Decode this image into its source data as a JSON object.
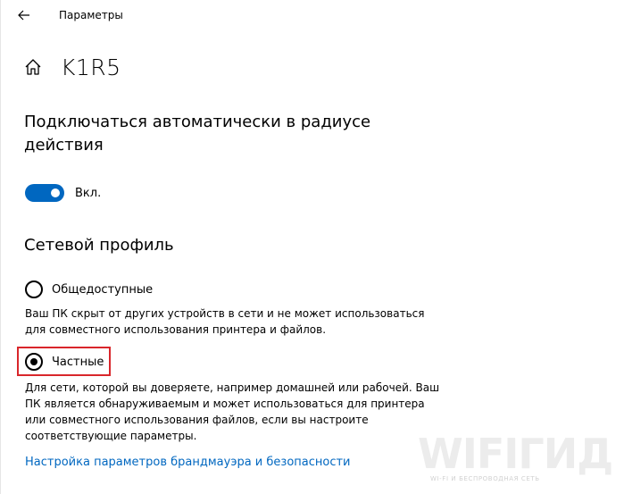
{
  "app": {
    "title": "Параметры"
  },
  "header": {
    "network_name": "K1R5"
  },
  "auto_connect": {
    "title": "Подключаться автоматически в радиусе действия",
    "toggle_state": "Вкл.",
    "toggle_on": true
  },
  "network_profile": {
    "title": "Сетевой профиль",
    "options": [
      {
        "label": "Общедоступные",
        "selected": false,
        "description": "Ваш ПК скрыт от других устройств в сети и не может использоваться для совместного использования принтера и файлов."
      },
      {
        "label": "Частные",
        "selected": true,
        "description": "Для сети, которой вы доверяете, например домашней или рабочей. Ваш ПК является обнаруживаемым и может использоваться для принтера или совместного использования файлов, если вы настроите соответствующие параметры."
      }
    ]
  },
  "firewall_link": "Настройка параметров брандмауэра и безопасности",
  "watermark": {
    "main": "WIFIГИД",
    "sub": "WI-FI И БЕСПРОВОДНАЯ СЕТЬ"
  },
  "colors": {
    "accent": "#0067c0",
    "highlight": "#d9262b",
    "watermark": "#e9e9e9"
  },
  "icons": {
    "back": "arrow-left-icon",
    "home": "home-icon"
  }
}
